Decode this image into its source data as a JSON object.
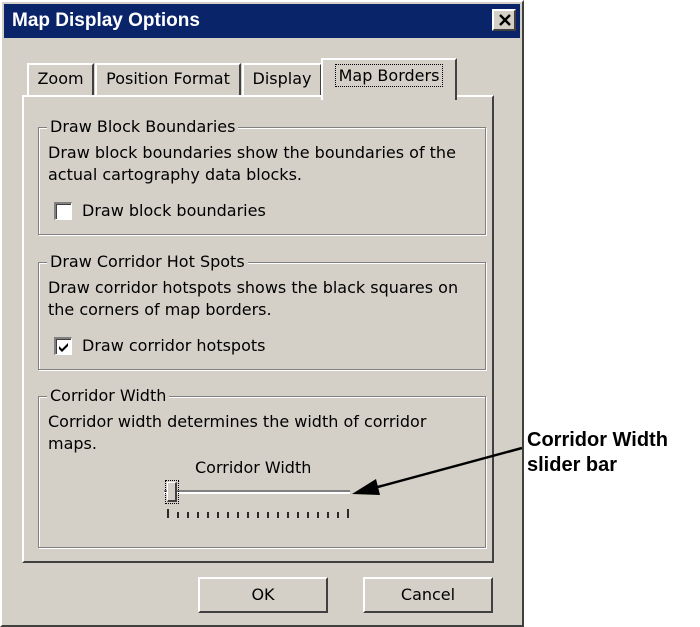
{
  "window": {
    "title": "Map Display Options",
    "close_glyph": "✕"
  },
  "tabs": [
    {
      "label": "Zoom",
      "active": false
    },
    {
      "label": "Position Format",
      "active": false
    },
    {
      "label": "Display",
      "active": false
    },
    {
      "label": "Map Borders",
      "active": true
    }
  ],
  "groups": {
    "block_boundaries": {
      "title": "Draw Block Boundaries",
      "description": "Draw block boundaries show the boundaries of the actual cartography data blocks.",
      "checkbox_label": "Draw block boundaries",
      "checked": false
    },
    "corridor_hotspots": {
      "title": "Draw Corridor Hot Spots",
      "description": "Draw corridor hotspots shows the black squares on the corners of map borders.",
      "checkbox_label": "Draw corridor hotspots",
      "checked": true
    },
    "corridor_width": {
      "title": "Corridor Width",
      "description": "Corridor width determines the width of corridor maps.",
      "slider_label": "Corridor Width",
      "slider_value_fraction": 0.0
    }
  },
  "buttons": {
    "ok_label": "OK",
    "cancel_label": "Cancel"
  },
  "callout": {
    "line1": "Corridor Width",
    "line2": "slider bar"
  },
  "colors": {
    "face": "#d4d0c8",
    "titlebar": "#0a246a",
    "title_text": "#ffffff"
  }
}
